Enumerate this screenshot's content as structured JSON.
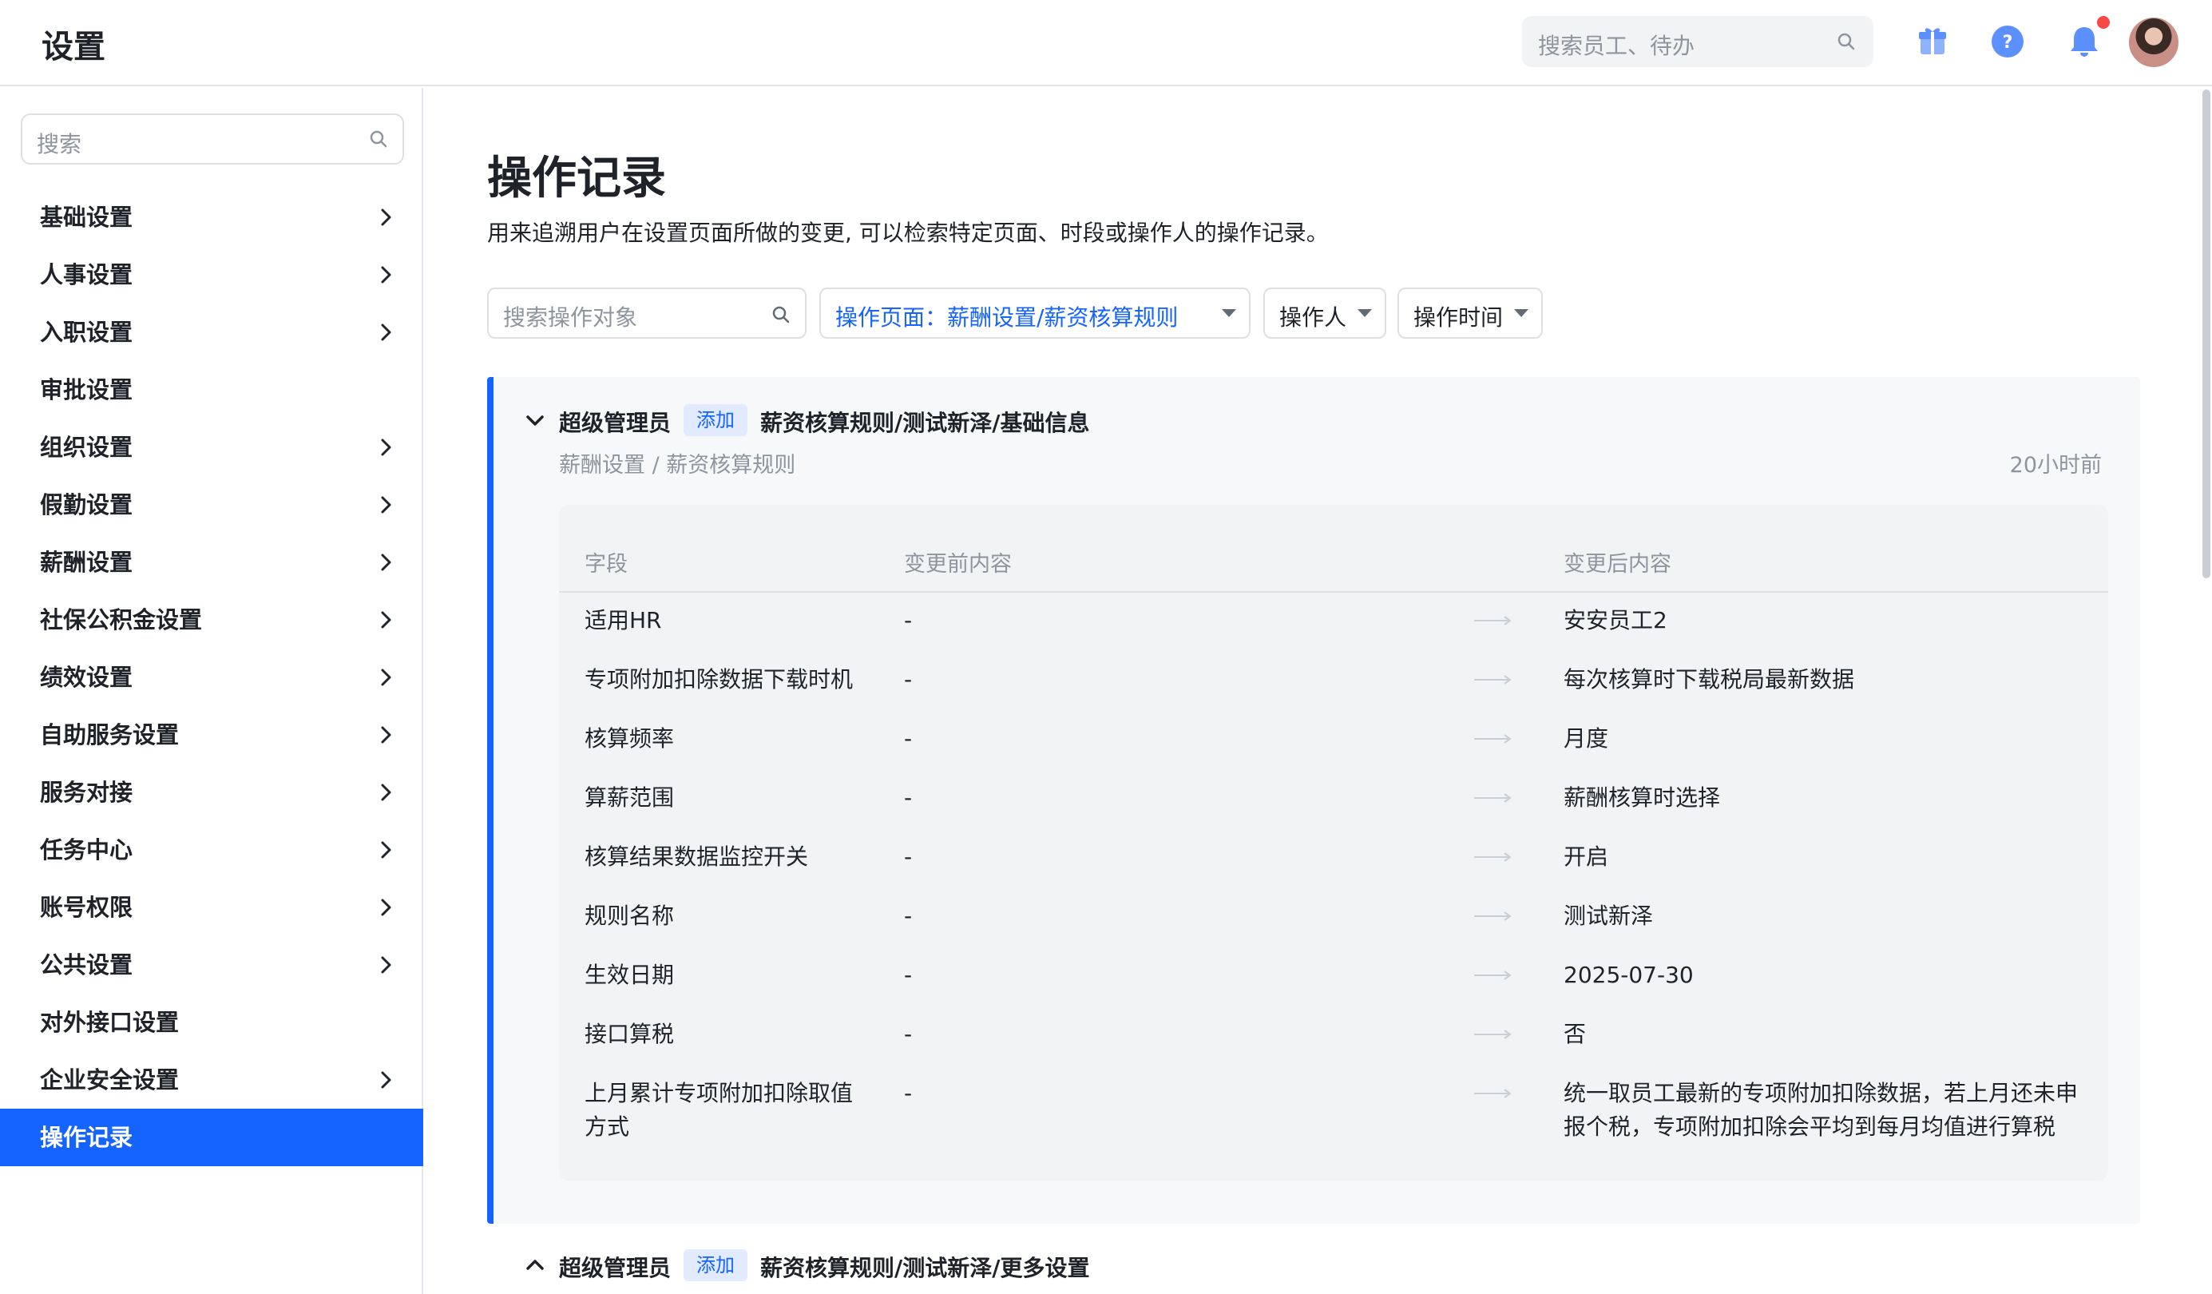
{
  "header": {
    "title": "设置",
    "search_placeholder": "搜索员工、待办",
    "icons": [
      "gift-icon",
      "help-icon",
      "bell-icon"
    ],
    "has_notification": true
  },
  "sidebar": {
    "search_placeholder": "搜索",
    "items": [
      {
        "label": "基础设置",
        "has_children": true
      },
      {
        "label": "人事设置",
        "has_children": true
      },
      {
        "label": "入职设置",
        "has_children": true
      },
      {
        "label": "审批设置",
        "has_children": false
      },
      {
        "label": "组织设置",
        "has_children": true
      },
      {
        "label": "假勤设置",
        "has_children": true
      },
      {
        "label": "薪酬设置",
        "has_children": true
      },
      {
        "label": "社保公积金设置",
        "has_children": true
      },
      {
        "label": "绩效设置",
        "has_children": true
      },
      {
        "label": "自助服务设置",
        "has_children": true
      },
      {
        "label": "服务对接",
        "has_children": true
      },
      {
        "label": "任务中心",
        "has_children": true
      },
      {
        "label": "账号权限",
        "has_children": true
      },
      {
        "label": "公共设置",
        "has_children": true
      },
      {
        "label": "对外接口设置",
        "has_children": false
      },
      {
        "label": "企业安全设置",
        "has_children": true
      },
      {
        "label": "操作记录",
        "has_children": false,
        "active": true
      }
    ]
  },
  "main": {
    "title": "操作记录",
    "description": "用来追溯用户在设置页面所做的变更, 可以检索特定页面、时段或操作人的操作记录。",
    "filters": {
      "search_placeholder": "搜索操作对象",
      "page_filter": "操作页面：薪酬设置/薪资核算规则",
      "operator_filter": "操作人",
      "time_filter": "操作时间"
    },
    "records": [
      {
        "expanded": true,
        "operator": "超级管理员",
        "action": "添加",
        "target": "薪资核算规则/测试新泽/基础信息",
        "path": "薪酬设置 / 薪资核算规则",
        "time": "20小时前",
        "columns": {
          "field": "字段",
          "before": "变更前内容",
          "after": "变更后内容"
        },
        "changes": [
          {
            "field": "适用HR",
            "before": "-",
            "after": "安安员工2"
          },
          {
            "field": "专项附加扣除数据下载时机",
            "before": "-",
            "after": "每次核算时下载税局最新数据"
          },
          {
            "field": "核算频率",
            "before": "-",
            "after": "月度"
          },
          {
            "field": "算薪范围",
            "before": "-",
            "after": "薪酬核算时选择"
          },
          {
            "field": "核算结果数据监控开关",
            "before": "-",
            "after": "开启"
          },
          {
            "field": "规则名称",
            "before": "-",
            "after": "测试新泽"
          },
          {
            "field": "生效日期",
            "before": "-",
            "after": "2025-07-30"
          },
          {
            "field": "接口算税",
            "before": "-",
            "after": "否"
          },
          {
            "field": "上月累计专项附加扣除取值方式",
            "before": "-",
            "after": "统一取员工最新的专项附加扣除数据，若上月还未申报个税，专项附加扣除会平均到每月均值进行算税"
          }
        ]
      },
      {
        "expanded": false,
        "operator": "超级管理员",
        "action": "添加",
        "target": "薪资核算规则/测试新泽/更多设置"
      }
    ]
  },
  "colors": {
    "accent": "#1664ff",
    "tag_bg": "#e1eaff",
    "muted": "#8f959e",
    "notification": "#f54a45"
  }
}
